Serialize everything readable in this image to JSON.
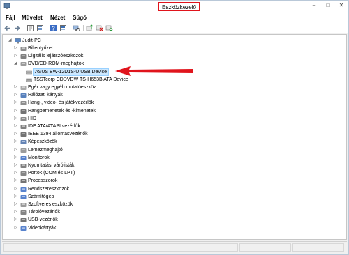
{
  "window": {
    "title": "Eszközkezelő",
    "controls": {
      "minimize": "–",
      "maximize": "□",
      "close": "✕"
    }
  },
  "menu": {
    "items": [
      "Fájl",
      "Művelet",
      "Nézet",
      "Súgó"
    ]
  },
  "toolbar": {
    "icons": [
      "back-icon",
      "forward-icon",
      "properties-icon",
      "list-icon",
      "help-icon",
      "view-icon",
      "scan-hardware-icon",
      "update-driver-icon",
      "disable-device-icon",
      "uninstall-device-icon"
    ]
  },
  "tree": {
    "root": "Judit-PC",
    "categories": [
      {
        "label": "Billentyűzet",
        "icon": "keyboard-icon",
        "expanded": false
      },
      {
        "label": "Digitális lejátszóeszközök",
        "icon": "media-player-icon",
        "expanded": false
      },
      {
        "label": "DVD/CD-ROM-meghajtók",
        "icon": "dvd-drive-icon",
        "expanded": true,
        "children": [
          {
            "label": "ASUS BW-12D1S-U USB Device",
            "selected": true
          },
          {
            "label": "TSSTcorp CDDVDW TS-H653B ATA Device",
            "selected": false
          }
        ]
      },
      {
        "label": "Egér vagy egyéb mutatóeszköz",
        "icon": "mouse-icon",
        "expanded": false
      },
      {
        "label": "Hálózati kártyák",
        "icon": "network-icon",
        "expanded": false
      },
      {
        "label": "Hang-, video- és játékvezérlők",
        "icon": "sound-icon",
        "expanded": false
      },
      {
        "label": "Hangbemenetek és -kimenetek",
        "icon": "audio-io-icon",
        "expanded": false
      },
      {
        "label": "HID",
        "icon": "hid-icon",
        "expanded": false
      },
      {
        "label": "IDE ATA/ATAPI vezérlők",
        "icon": "ide-icon",
        "expanded": false
      },
      {
        "label": "IEEE 1394 állomásvezérlők",
        "icon": "ieee1394-icon",
        "expanded": false
      },
      {
        "label": "Képeszközök",
        "icon": "camera-icon",
        "expanded": false
      },
      {
        "label": "Lemezmeghajtó",
        "icon": "disk-drive-icon",
        "expanded": false
      },
      {
        "label": "Monitorok",
        "icon": "monitor-icon",
        "expanded": false
      },
      {
        "label": "Nyomtatási várólisták",
        "icon": "printer-icon",
        "expanded": false
      },
      {
        "label": "Portok (COM és LPT)",
        "icon": "port-icon",
        "expanded": false
      },
      {
        "label": "Processzorok",
        "icon": "processor-icon",
        "expanded": false
      },
      {
        "label": "Rendszereszközök",
        "icon": "system-device-icon",
        "expanded": false
      },
      {
        "label": "Számítógép",
        "icon": "computer-icon",
        "expanded": false
      },
      {
        "label": "Szoftveres eszközök",
        "icon": "software-device-icon",
        "expanded": false
      },
      {
        "label": "Tárolóvezérlők",
        "icon": "storage-controller-icon",
        "expanded": false
      },
      {
        "label": "USB-vezérlők",
        "icon": "usb-icon",
        "expanded": false
      },
      {
        "label": "Videokártyák",
        "icon": "video-card-icon",
        "expanded": false
      }
    ]
  },
  "colors": {
    "title_highlight": "#e0141c",
    "annotation_arrow": "#e0141c",
    "selection_bg": "#cde8ff",
    "selection_border": "#99d1ff"
  }
}
